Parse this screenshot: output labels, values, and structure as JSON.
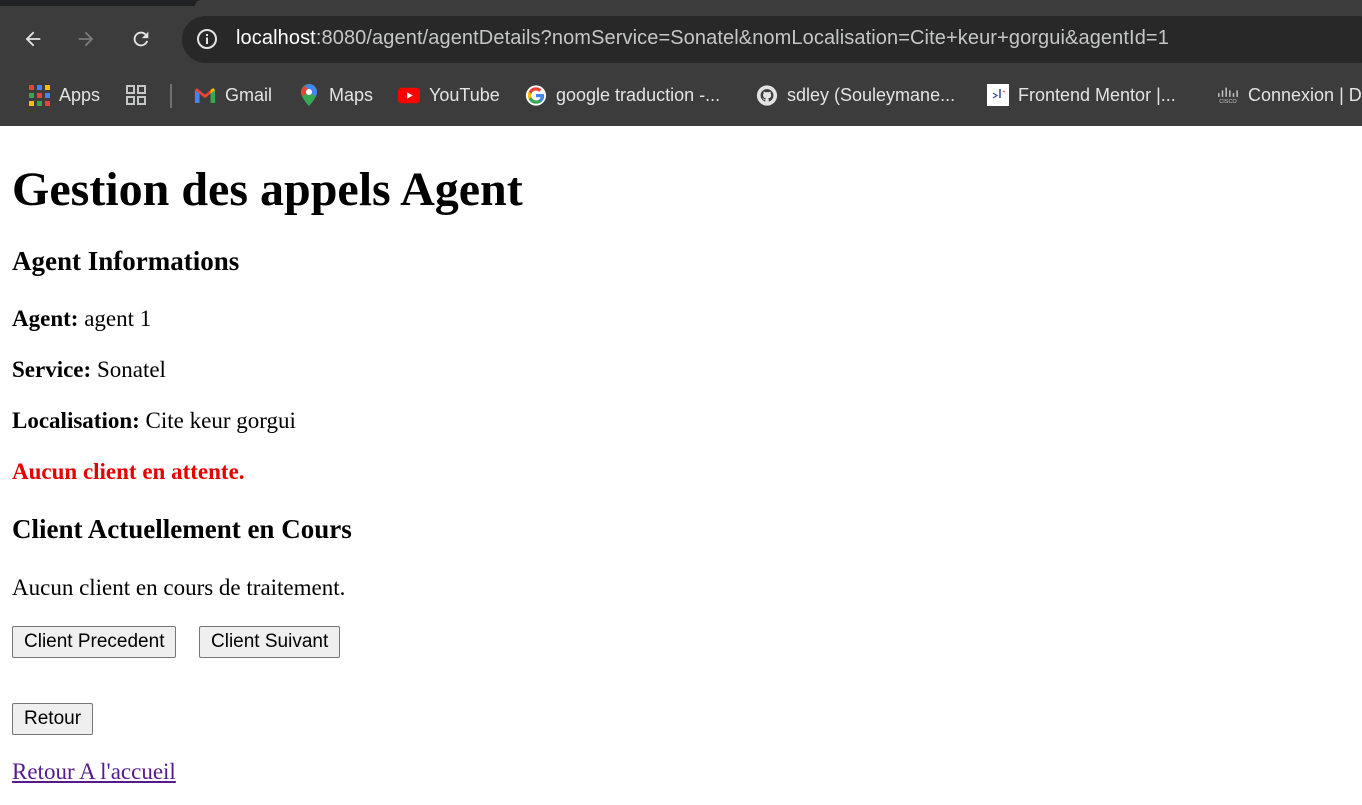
{
  "browser": {
    "url_host": "localhost",
    "url_rest": ":8080/agent/agentDetails?nomService=Sonatel&nomLocalisation=Cite+keur+gorgui&agentId=1",
    "bookmarks": [
      {
        "label": "Apps",
        "icon": "apps-grid-icon"
      },
      {
        "label": "",
        "icon": "tab-groups-icon"
      },
      {
        "label": "Gmail",
        "icon": "gmail-icon"
      },
      {
        "label": "Maps",
        "icon": "maps-pin-icon"
      },
      {
        "label": "YouTube",
        "icon": "youtube-icon"
      },
      {
        "label": "google traduction -...",
        "icon": "google-icon"
      },
      {
        "label": "sdley (Souleymane...",
        "icon": "github-icon"
      },
      {
        "label": "Frontend Mentor |...",
        "icon": "frontend-mentor-icon"
      },
      {
        "label": "Connexion | D",
        "icon": "cisco-icon"
      }
    ]
  },
  "page": {
    "title": "Gestion des appels Agent",
    "section_agent": "Agent Informations",
    "agent_label": "Agent:",
    "agent_value": "agent 1",
    "service_label": "Service:",
    "service_value": "Sonatel",
    "localisation_label": "Localisation:",
    "localisation_value": "Cite keur gorgui",
    "waiting_message": "Aucun client en attente.",
    "section_current": "Client Actuellement en Cours",
    "current_message": "Aucun client en cours de traitement.",
    "btn_previous": "Client Precedent",
    "btn_next": "Client Suivant",
    "btn_back": "Retour",
    "home_link": "Retour A l'accueil"
  },
  "colors": {
    "warning": "#e60000",
    "visited_link": "#551a8b",
    "chrome_bg": "#3c3c3c"
  }
}
